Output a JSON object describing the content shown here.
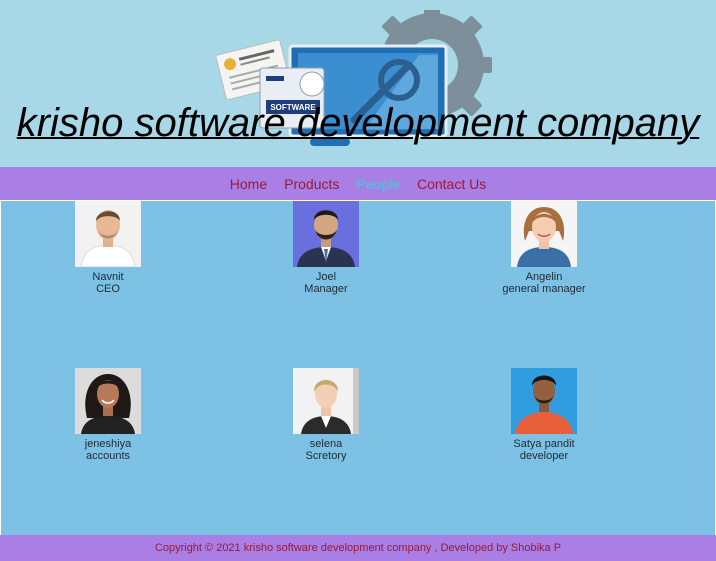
{
  "header": {
    "title": "krisho software development company",
    "art_label": "SOFTWARE",
    "license_label": "SOFTWARE LICENSE"
  },
  "nav": {
    "items": [
      {
        "label": "Home",
        "active": false
      },
      {
        "label": "Products",
        "active": false
      },
      {
        "label": "People",
        "active": true
      },
      {
        "label": "Contact Us",
        "active": false
      }
    ]
  },
  "people": [
    {
      "name": "Navnit",
      "role": "CEO"
    },
    {
      "name": "Joel",
      "role": "Manager"
    },
    {
      "name": "Angelin",
      "role": "general manager"
    },
    {
      "name": "jeneshiya",
      "role": "accounts"
    },
    {
      "name": "selena",
      "role": "Scretory"
    },
    {
      "name": "Satya pandit",
      "role": "developer"
    }
  ],
  "footer": {
    "text": "Copyright © 2021 krisho software development company , Developed by Shobika P"
  },
  "colors": {
    "header_bg": "#a8d8e8",
    "nav_bg": "#a97fe6",
    "main_bg": "#7dc1e5",
    "link": "#9b1a35",
    "link_active": "#48c9d8"
  }
}
